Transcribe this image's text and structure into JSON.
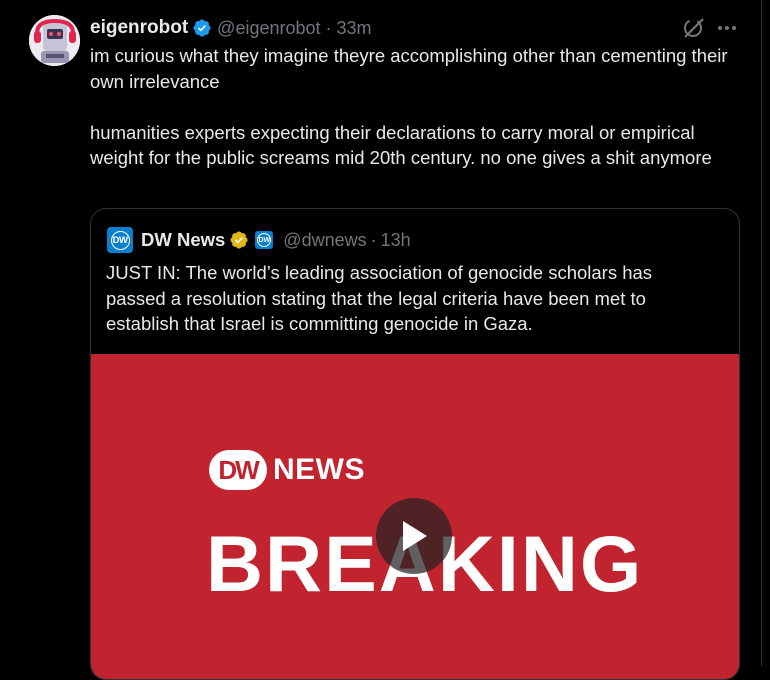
{
  "post": {
    "display_name": "eigenrobot",
    "handle": "@eigenrobot",
    "separator": "·",
    "time": "33m",
    "text": "im curious what they imagine theyre accomplishing other than cementing their own irrelevance\n\nhumanities experts expecting their declarations to carry moral or empirical weight for the public screams mid 20th century. no one gives a shit anymore",
    "icons": {
      "verified": "verified-badge-icon",
      "grok": "grok-icon",
      "more": "more-options-icon"
    }
  },
  "quote": {
    "avatar_text": "DW",
    "display_name": "DW News",
    "affiliate_text": "DW",
    "handle": "@dwnews",
    "separator": "·",
    "time": "13h",
    "text": "JUST IN: The world’s leading association of genocide scholars has passed a resolution stating that the legal criteria have been met to establish that Israel is committing genocide in Gaza.",
    "media": {
      "logo_circle": "DW",
      "logo_text": "NEWS",
      "headline": "BREAKING",
      "background_color": "#c1232f",
      "play_icon": "play-icon"
    }
  },
  "colors": {
    "background": "#000000",
    "text_primary": "#e7e9ea",
    "text_secondary": "#71767b",
    "verified_blue": "#1d9bf0",
    "verified_gold": "#e2b719",
    "dw_blue": "#0d7fcf"
  }
}
